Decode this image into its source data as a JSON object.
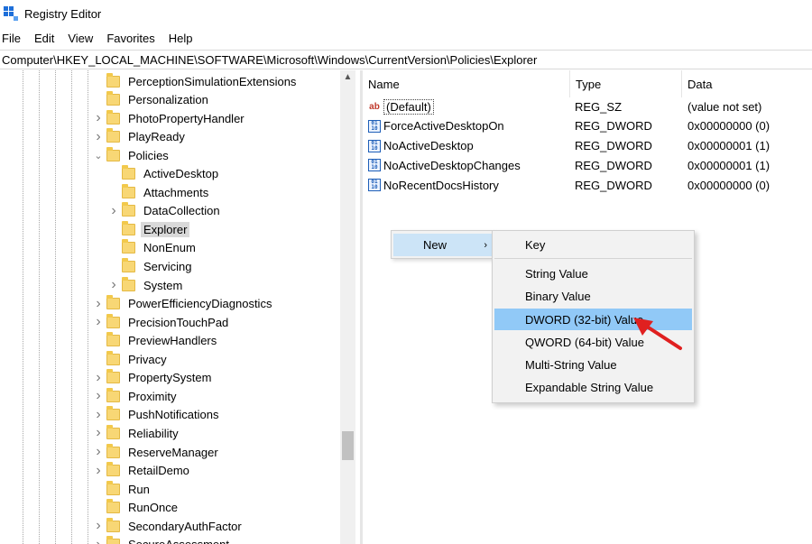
{
  "window": {
    "title": "Registry Editor"
  },
  "menu": [
    "File",
    "Edit",
    "View",
    "Favorites",
    "Help"
  ],
  "address": "Computer\\HKEY_LOCAL_MACHINE\\SOFTWARE\\Microsoft\\Windows\\CurrentVersion\\Policies\\Explorer",
  "tree": [
    {
      "label": "PerceptionSimulationExtensions",
      "level": 0,
      "expander": "none"
    },
    {
      "label": "Personalization",
      "level": 0,
      "expander": "none"
    },
    {
      "label": "PhotoPropertyHandler",
      "level": 0,
      "expander": "collapsed"
    },
    {
      "label": "PlayReady",
      "level": 0,
      "expander": "collapsed"
    },
    {
      "label": "Policies",
      "level": 0,
      "expander": "expanded"
    },
    {
      "label": "ActiveDesktop",
      "level": 1,
      "expander": "none"
    },
    {
      "label": "Attachments",
      "level": 1,
      "expander": "none"
    },
    {
      "label": "DataCollection",
      "level": 1,
      "expander": "collapsed"
    },
    {
      "label": "Explorer",
      "level": 1,
      "expander": "none",
      "selected": true
    },
    {
      "label": "NonEnum",
      "level": 1,
      "expander": "none"
    },
    {
      "label": "Servicing",
      "level": 1,
      "expander": "none"
    },
    {
      "label": "System",
      "level": 1,
      "expander": "collapsed"
    },
    {
      "label": "PowerEfficiencyDiagnostics",
      "level": 0,
      "expander": "collapsed"
    },
    {
      "label": "PrecisionTouchPad",
      "level": 0,
      "expander": "collapsed"
    },
    {
      "label": "PreviewHandlers",
      "level": 0,
      "expander": "none"
    },
    {
      "label": "Privacy",
      "level": 0,
      "expander": "none"
    },
    {
      "label": "PropertySystem",
      "level": 0,
      "expander": "collapsed"
    },
    {
      "label": "Proximity",
      "level": 0,
      "expander": "collapsed"
    },
    {
      "label": "PushNotifications",
      "level": 0,
      "expander": "collapsed"
    },
    {
      "label": "Reliability",
      "level": 0,
      "expander": "collapsed"
    },
    {
      "label": "ReserveManager",
      "level": 0,
      "expander": "collapsed"
    },
    {
      "label": "RetailDemo",
      "level": 0,
      "expander": "collapsed"
    },
    {
      "label": "Run",
      "level": 0,
      "expander": "none"
    },
    {
      "label": "RunOnce",
      "level": 0,
      "expander": "none"
    },
    {
      "label": "SecondaryAuthFactor",
      "level": 0,
      "expander": "collapsed"
    },
    {
      "label": "SecureAssessment",
      "level": 0,
      "expander": "collapsed"
    }
  ],
  "list": {
    "columns": [
      "Name",
      "Type",
      "Data"
    ],
    "rows": [
      {
        "name": "(Default)",
        "type": "REG_SZ",
        "data": "(value not set)",
        "icon": "string-value-icon"
      },
      {
        "name": "ForceActiveDesktopOn",
        "type": "REG_DWORD",
        "data": "0x00000000 (0)",
        "icon": "binary-value-icon"
      },
      {
        "name": "NoActiveDesktop",
        "type": "REG_DWORD",
        "data": "0x00000001 (1)",
        "icon": "binary-value-icon"
      },
      {
        "name": "NoActiveDesktopChanges",
        "type": "REG_DWORD",
        "data": "0x00000001 (1)",
        "icon": "binary-value-icon"
      },
      {
        "name": "NoRecentDocsHistory",
        "type": "REG_DWORD",
        "data": "0x00000000 (0)",
        "icon": "binary-value-icon"
      }
    ]
  },
  "context_menu": {
    "new_label": "New"
  },
  "submenu": [
    {
      "label": "Key"
    },
    {
      "label": "String Value"
    },
    {
      "label": "Binary Value"
    },
    {
      "label": "DWORD (32-bit) Value",
      "highlighted": true
    },
    {
      "label": "QWORD (64-bit) Value"
    },
    {
      "label": "Multi-String Value"
    },
    {
      "label": "Expandable String Value"
    }
  ],
  "colors": {
    "highlight": "#91c9f7",
    "hover": "#cce4f7",
    "folder": "#f8d775",
    "arrow": "#e02020"
  }
}
